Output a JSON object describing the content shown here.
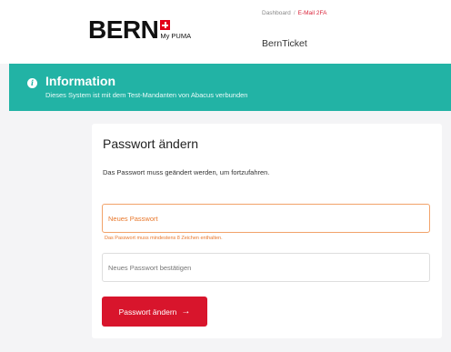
{
  "header": {
    "logo_word": "BERN",
    "logo_sub": "My PUMA",
    "breadcrumb": {
      "home": "Dashboard",
      "separator": "/",
      "current": "E-Mail 2FA"
    },
    "app_name": "BernTicket"
  },
  "banner": {
    "title": "Information",
    "text": "Dieses System ist mit dem Test-Mandanten von Abacus verbunden",
    "icon": "info-icon",
    "color": "#22b3a5"
  },
  "form": {
    "title": "Passwort ändern",
    "description": "Das Passwort muss geändert werden, um fortzufahren.",
    "new_password": {
      "value": "",
      "placeholder": "Neues Passwort",
      "error": "Das Passwort muss mindestens 8 Zeichen enthalten."
    },
    "confirm_password": {
      "value": "",
      "placeholder": "Neues Passwort bestätigen"
    },
    "submit_label": "Passwort ändern",
    "submit_icon": "arrow-right-icon",
    "submit_arrow": "→",
    "accent_color": "#d8152c"
  }
}
